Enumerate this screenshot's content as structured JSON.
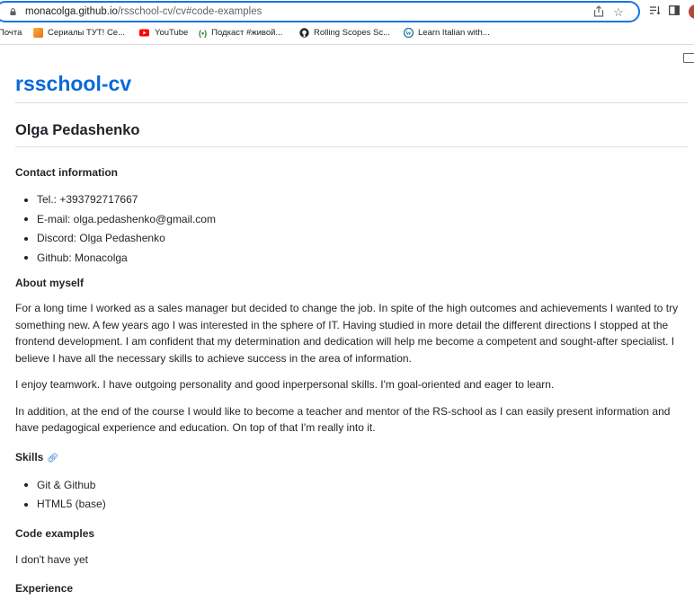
{
  "browser": {
    "url_host": "monacolga.github.io",
    "url_path": "/rsschool-cv/cv#code-examples",
    "bookmarks": [
      {
        "label": "Почта",
        "icon": "mail-icon",
        "color": ""
      },
      {
        "label": "Сериалы ТУТ! Се...",
        "icon": "tv-series-icon",
        "color": "#e8701a"
      },
      {
        "label": "YouTube",
        "icon": "youtube-icon",
        "color": "#ff0000"
      },
      {
        "label": "Подкаст #живой...",
        "icon": "podcast-icon",
        "color": "#2e7d32"
      },
      {
        "label": "Rolling Scopes Sc...",
        "icon": "github-icon",
        "color": "#24292f"
      },
      {
        "label": "Learn Italian with...",
        "icon": "wordpress-icon",
        "color": "#21759b"
      }
    ]
  },
  "site": {
    "title": "rsschool-cv"
  },
  "cv": {
    "name": "Olga Pedashenko",
    "contact": {
      "heading": "Contact information",
      "items": [
        "Tel.: +393792717667",
        "E-mail: olga.pedashenko@gmail.com",
        "Discord: Olga Pedashenko",
        "Github: Monacolga"
      ]
    },
    "about": {
      "heading": "About myself",
      "paragraphs": [
        "For a long time I worked as a sales manager but decided to change the job. In spite of the high outcomes and achievements I wanted to try something new. A few years ago I was interested in the sphere of IT. Having studied in more detail the different directions I stopped at the frontend development. I am confident that my determination and dedication will help me become a competent and sought-after specialist. I believe I have all the necessary skills to achieve success in the area of information.",
        "I enjoy teamwork. I have outgoing personality and good inperpersonal skills. I'm goal-oriented and eager to learn.",
        "In addition, at the end of the course I would like to become a teacher and mentor of the RS-school as I can easily present information and have pedagogical experience and education. On top of that I'm really into it."
      ]
    },
    "skills": {
      "heading": "Skills",
      "items": [
        "Git & Github",
        "HTML5 (base)"
      ]
    },
    "code_examples": {
      "heading": "Code examples",
      "text": "I don't have yet"
    },
    "experience": {
      "heading": "Experience"
    }
  },
  "colors": {
    "accent": "#0969da",
    "omnibox_border": "#1a73e8"
  }
}
